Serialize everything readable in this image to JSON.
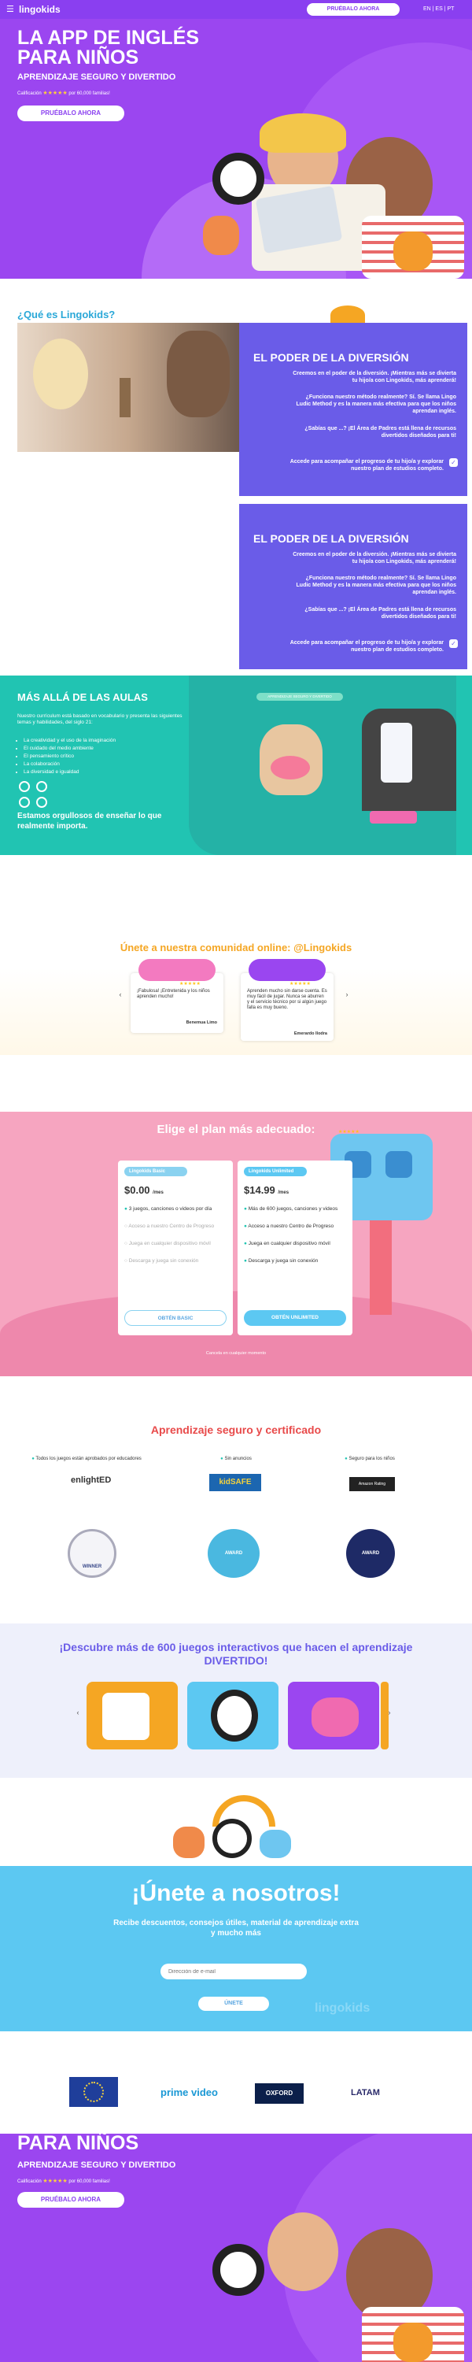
{
  "header": {
    "logo": "lingokids",
    "cta": "PRUÉBALO AHORA",
    "langs": "EN | ES | PT"
  },
  "hero": {
    "title_line1": "LA APP DE INGLÉS",
    "title_line2": "PARA NIÑOS",
    "subtitle": "APRENDIZAJE SEGURO Y DIVERTIDO",
    "rating_label": "Calificación",
    "stars": "★★★★★",
    "rating_count": "por 60,000 familias!",
    "button": "PRUÉBALO AHORA"
  },
  "about": {
    "title": "¿Qué es Lingokids?",
    "panels": [
      {
        "heading": "EL PODER DE LA DIVERSIÓN",
        "p1": "Creemos en el poder de la diversión. ¡Mientras más se divierta tu hijo/a con Lingokids, más aprenderá!",
        "p2": "¿Funciona nuestro método realmente? Sí. Se llama Lingo Ludic Method y es la manera más efectiva para que los niños aprendan inglés.",
        "p3": "¿Sabías que ...? ¡El Área de Padres está llena de recursos divertidos diseñados para ti!",
        "p4": "Accede para acompañar el progreso de tu hijo/a y explorar nuestro plan de estudios completo."
      },
      {
        "heading": "EL PODER DE LA DIVERSIÓN",
        "p1": "Creemos en el poder de la diversión. ¡Mientras más se divierta tu hijo/a con Lingokids, más aprenderá!",
        "p2": "¿Funciona nuestro método realmente? Sí. Se llama Lingo Ludic Method y es la manera más efectiva para que los niños aprendan inglés.",
        "p3": "¿Sabías que ...? ¡El Área de Padres está llena de recursos divertidos diseñados para ti!",
        "p4": "Accede para acompañar el progreso de tu hijo/a y explorar nuestro plan de estudios completo."
      }
    ]
  },
  "beyond": {
    "title": "MÁS ALLÁ DE LAS AULAS",
    "intro": "Nuestro currículum está basado en vocabulario y presenta las siguientes temas y habilidades, del siglo 21:",
    "items": [
      "La creatividad y el uso de la imaginación",
      "El cuidado del medio ambiente",
      "El pensamiento crítico",
      "La colaboración",
      "La diversidad e igualdad"
    ],
    "closing": "Estamos orgullosos de enseñar lo que realmente importa.",
    "badge": "APRENDIZAJE SEGURO Y DIVERTIDO"
  },
  "community": {
    "title": "Únete a nuestra comunidad online: @Lingokids",
    "reviews": [
      {
        "text": "¡Fabulosa! ¡Entretenida y los niños aprenden mucho!",
        "author": "Benemua Limo",
        "stars": "★★★★★"
      },
      {
        "text": "Aprenden mucho sin darse cuenta. Es muy fácil de jugar. Nunca se aburren y el servicio técnico por si algún juego falla es muy bueno.",
        "author": "Emerardo Ilodra",
        "stars": "★★★★★"
      }
    ]
  },
  "plans": {
    "title": "Elige el plan más adecuado:",
    "basic": {
      "tag": "Lingokids Basic",
      "price": "$0.00",
      "period": "/mes",
      "features": [
        "3 juegos, canciones o videos por día",
        "Acceso a nuestro Centro de Progreso",
        "Juega en cualquier dispositivo móvil",
        "Descarga y juega sin conexión"
      ],
      "button": "OBTÉN BASIC"
    },
    "unlimited": {
      "tag": "Lingokids Unlimited",
      "price": "$14.99",
      "period": "/mes",
      "features": [
        "Más de 600 juegos, canciones y videos",
        "Acceso a nuestro Centro de Progreso",
        "Juega en cualquier dispositivo móvil",
        "Descarga y juega sin conexión"
      ],
      "button": "OBTÉN UNLIMITED"
    },
    "footnote": "Cancela en cualquier momento",
    "robot_stars": "★★★★★"
  },
  "certified": {
    "title": "Aprendizaje seguro y certificado",
    "cols": [
      {
        "label": "Todos los juegos están aprobados por educadores",
        "logo": "enlightED"
      },
      {
        "label": "Sin anuncios",
        "logo": "kidSAFE"
      },
      {
        "label": "Seguro para los niños",
        "logo": "Amazon Rating"
      }
    ],
    "awards": [
      "WINNER",
      "AWARD",
      "AWARD"
    ]
  },
  "discover": {
    "title": "¡Descubre más de 600 juegos interactivos que hacen el aprendizaje DIVERTIDO!"
  },
  "join": {
    "title": "¡Únete a nosotros!",
    "subtitle": "Recibe descuentos, consejos útiles, material de aprendizaje extra y mucho más",
    "placeholder": "Dirección de e-mail",
    "button": "ÚNETE",
    "watermark": "lingokids"
  },
  "partners": {
    "items": [
      "prime video",
      "OXFORD",
      "LATAM"
    ]
  },
  "colors": {
    "purple": "#9b46f0",
    "teal": "#21c4b2",
    "pink": "#f6a5c0",
    "blue": "#5cc8f2",
    "indigo": "#6a5ce8"
  }
}
